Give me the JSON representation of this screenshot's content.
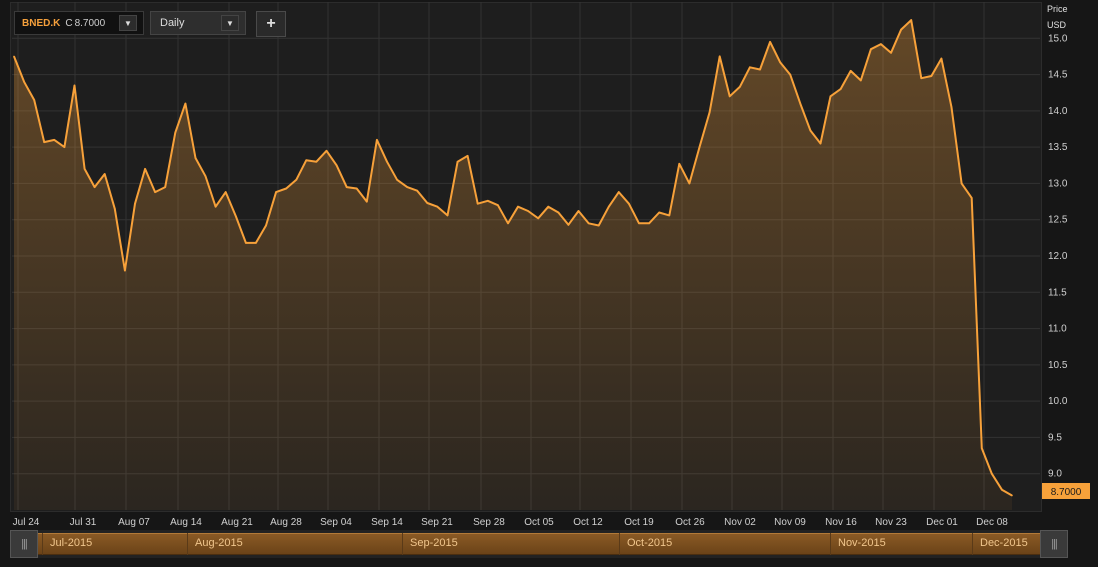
{
  "toolbar": {
    "symbol": "BNED.K",
    "close_prefix": "C",
    "close_value": "8.7000",
    "interval": "Daily",
    "add_label": "+"
  },
  "axis": {
    "price_title": "Price",
    "currency": "USD"
  },
  "last_price_label": "8.7000",
  "colors": {
    "line": "#f7a13a",
    "background": "#1e1e1e",
    "grid": "#333333",
    "accent": "#f5a03c"
  },
  "icons": {
    "symbol_dropdown": "chevron-down-icon",
    "interval_dropdown": "chevron-down-icon",
    "add": "plus-icon",
    "nav_handle": "grip-icon"
  },
  "navigator": {
    "labels": [
      "Jul-2015",
      "Aug-2015",
      "Sep-2015",
      "Oct-2015",
      "Nov-2015",
      "Dec-2015"
    ]
  },
  "chart_data": {
    "type": "area",
    "title": "",
    "xlabel": "",
    "ylabel": "Price USD",
    "ylim": [
      8.5,
      15.5
    ],
    "y_ticks": [
      "9.0",
      "9.5",
      "10.0",
      "10.5",
      "11.0",
      "11.5",
      "12.0",
      "12.5",
      "13.0",
      "13.5",
      "14.0",
      "14.5",
      "15.0"
    ],
    "x_tick_labels": [
      "Jul 24",
      "Jul 31",
      "Aug 07",
      "Aug 14",
      "Aug 21",
      "Aug 28",
      "Sep 04",
      "Sep 14",
      "Sep 21",
      "Sep 28",
      "Oct 05",
      "Oct 12",
      "Oct 19",
      "Oct 26",
      "Nov 02",
      "Nov 09",
      "Nov 16",
      "Nov 23",
      "Dec 01",
      "Dec 08"
    ],
    "grid": true,
    "series": [
      {
        "values": [
          14.75,
          14.4,
          14.15,
          13.57,
          13.6,
          13.5,
          14.35,
          13.2,
          12.95,
          13.13,
          12.65,
          11.8,
          12.72,
          13.2,
          12.88,
          12.95,
          13.7,
          14.1,
          13.35,
          13.1,
          12.68,
          12.88,
          12.55,
          12.18,
          12.18,
          12.42,
          12.88,
          12.93,
          13.05,
          13.32,
          13.3,
          13.45,
          13.25,
          12.95,
          12.93,
          12.75,
          13.6,
          13.3,
          13.05,
          12.95,
          12.9,
          12.73,
          12.68,
          12.56,
          13.3,
          13.38,
          12.72,
          12.76,
          12.7,
          12.45,
          12.68,
          12.62,
          12.52,
          12.68,
          12.6,
          12.43,
          12.62,
          12.45,
          12.42,
          12.68,
          12.88,
          12.72,
          12.45,
          12.45,
          12.6,
          12.56,
          13.27,
          13.0,
          13.5,
          13.98,
          14.75,
          14.2,
          14.33,
          14.6,
          14.57,
          14.95,
          14.67,
          14.5,
          14.1,
          13.73,
          13.55,
          14.2,
          14.3,
          14.55,
          14.42,
          14.85,
          14.92,
          14.8,
          15.12,
          15.25,
          14.45,
          14.48,
          14.72,
          14.05,
          13.0,
          12.8,
          9.35,
          9.0,
          8.78,
          8.7
        ]
      }
    ]
  }
}
